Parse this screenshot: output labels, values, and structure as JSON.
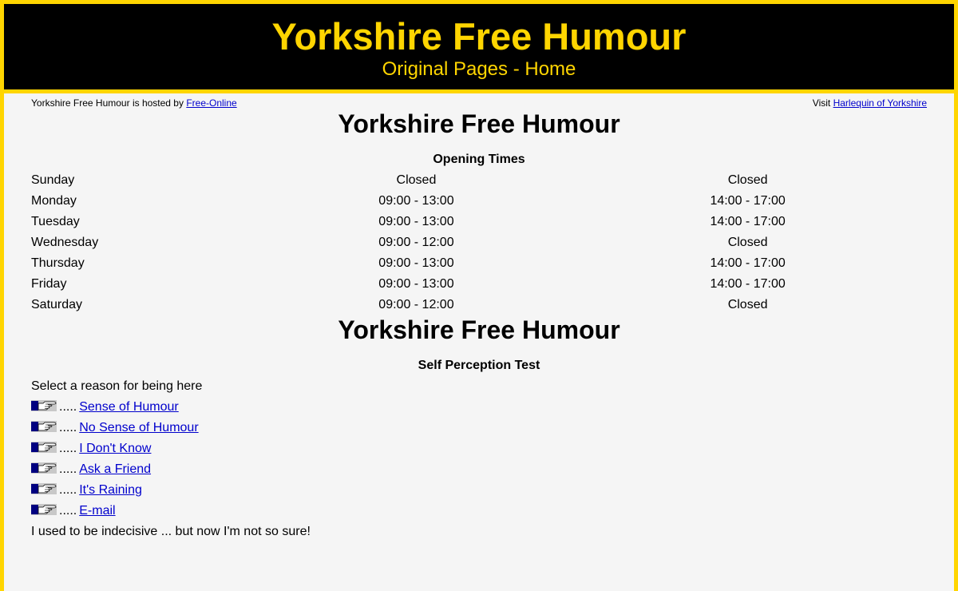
{
  "header": {
    "title": "Yorkshire Free Humour",
    "subtitle": "Original Pages - Home"
  },
  "hostbar": {
    "left_text": "Yorkshire Free Humour is hosted by",
    "left_link": "Free-Online",
    "right_text": "Visit",
    "right_link": "Harlequin of Yorkshire"
  },
  "section1": {
    "title": "Yorkshire Free Humour",
    "subtitle": "Opening Times",
    "rows": [
      {
        "day": "Sunday",
        "am": "Closed",
        "pm": "Closed"
      },
      {
        "day": "Monday",
        "am": "09:00 - 13:00",
        "pm": "14:00 - 17:00"
      },
      {
        "day": "Tuesday",
        "am": "09:00 - 13:00",
        "pm": "14:00 - 17:00"
      },
      {
        "day": "Wednesday",
        "am": "09:00 - 12:00",
        "pm": "Closed"
      },
      {
        "day": "Thursday",
        "am": "09:00 - 13:00",
        "pm": "14:00 - 17:00"
      },
      {
        "day": "Friday",
        "am": "09:00 - 13:00",
        "pm": "14:00 - 17:00"
      },
      {
        "day": "Saturday",
        "am": "09:00 - 12:00",
        "pm": "Closed"
      }
    ]
  },
  "section2": {
    "title": "Yorkshire Free Humour",
    "subtitle": "Self Perception Test",
    "prompt": "Select a reason for being here",
    "options": [
      {
        "dots": ".....",
        "label": "Sense of Humour"
      },
      {
        "dots": ".....",
        "label": "No Sense of Humour"
      },
      {
        "dots": ".....",
        "label": "I Don't Know"
      },
      {
        "dots": ".....",
        "label": "Ask a Friend"
      },
      {
        "dots": ".....",
        "label": "It's Raining"
      },
      {
        "dots": ".....",
        "label": "E-mail"
      }
    ],
    "footer": "I used to be indecisive ... but now I'm not so sure!"
  },
  "colors": {
    "accent": "#FFD500",
    "banner_bg": "#000000",
    "page_bg": "#F5F5F5",
    "link": "#0000CC"
  },
  "icons": {
    "option_bullet": "pointing-hand-icon"
  }
}
